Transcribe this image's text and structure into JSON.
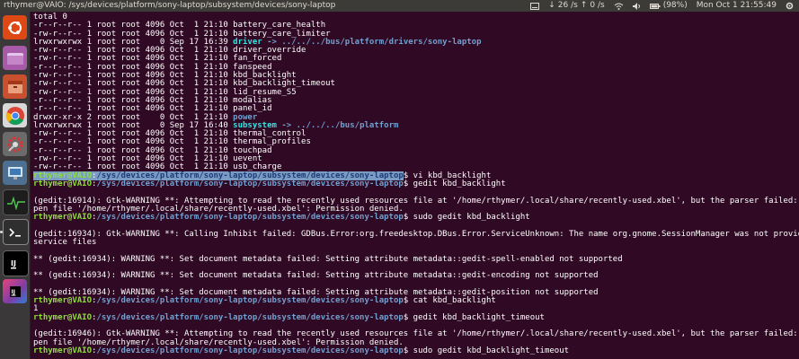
{
  "window": {
    "title": "rthymer@VAIO: /sys/devices/platform/sony-laptop/subsystem/devices/sony-laptop"
  },
  "panel": {
    "network_label": "26 /s",
    "network2_label": "0 /s",
    "battery_label": "(98%)",
    "clock": "Mon Oct  1 21:55:49"
  },
  "launcher": {
    "items": [
      {
        "name": "ubuntu-dash-icon",
        "color": "#e05a1d"
      },
      {
        "name": "files-icon",
        "color": "#b86ab9"
      },
      {
        "name": "archive-icon",
        "color": "#c55439"
      },
      {
        "name": "chrome-icon",
        "color": "#e8e8e8"
      },
      {
        "name": "settings-icon",
        "color": "#bbbbbb"
      },
      {
        "name": "network-icon",
        "color": "#3f7ab5"
      },
      {
        "name": "system-monitor-icon",
        "color": "#2f5f2f"
      },
      {
        "name": "terminal-icon",
        "color": "#2b2b2b"
      },
      {
        "name": "intellij-icon",
        "color": "#1a1a1a"
      },
      {
        "name": "intellij2-icon",
        "color": "#7b3ea9"
      }
    ]
  },
  "terminal": {
    "ls": {
      "total": "total 0",
      "rows": [
        {
          "perms": "-r--r--r-- 1 root root 4096 Oct  1 21:10 ",
          "name": "battery_care_health",
          "type": "file"
        },
        {
          "perms": "-rw-r--r-- 1 root root 4096 Oct  1 21:10 ",
          "name": "battery_care_limiter",
          "type": "file"
        },
        {
          "perms": "lrwxrwxrwx 1 root root    0 Sep 17 16:39 ",
          "name": "driver",
          "type": "link",
          "target": " -> ../../../bus/platform/drivers/sony-laptop"
        },
        {
          "perms": "-rw-r--r-- 1 root root 4096 Oct  1 21:10 ",
          "name": "driver_override",
          "type": "file"
        },
        {
          "perms": "-rw-r--r-- 1 root root 4096 Oct  1 21:10 ",
          "name": "fan_forced",
          "type": "file"
        },
        {
          "perms": "-r--r--r-- 1 root root 4096 Oct  1 21:10 ",
          "name": "fanspeed",
          "type": "file"
        },
        {
          "perms": "-rw-r--r-- 1 root root 4096 Oct  1 21:10 ",
          "name": "kbd_backlight",
          "type": "file"
        },
        {
          "perms": "-rw-r--r-- 1 root root 4096 Oct  1 21:10 ",
          "name": "kbd_backlight_timeout",
          "type": "file"
        },
        {
          "perms": "-rw-r--r-- 1 root root 4096 Oct  1 21:10 ",
          "name": "lid_resume_S5",
          "type": "file"
        },
        {
          "perms": "-r--r--r-- 1 root root 4096 Oct  1 21:10 ",
          "name": "modalias",
          "type": "file"
        },
        {
          "perms": "-r--r--r-- 1 root root 4096 Oct  1 21:10 ",
          "name": "panel_id",
          "type": "file"
        },
        {
          "perms": "drwxr-xr-x 2 root root    0 Oct  1 21:10 ",
          "name": "power",
          "type": "dir"
        },
        {
          "perms": "lrwxrwxrwx 1 root root    0 Sep 17 16:40 ",
          "name": "subsystem",
          "type": "link",
          "target": " -> ../../../bus/platform"
        },
        {
          "perms": "-rw-r--r-- 1 root root 4096 Oct  1 21:10 ",
          "name": "thermal_control",
          "type": "file"
        },
        {
          "perms": "-r--r--r-- 1 root root 4096 Oct  1 21:10 ",
          "name": "thermal_profiles",
          "type": "file"
        },
        {
          "perms": "-r--r--r-- 1 root root 4096 Oct  1 21:10 ",
          "name": "touchpad",
          "type": "file"
        },
        {
          "perms": "-rw-r--r-- 1 root root 4096 Oct  1 21:10 ",
          "name": "uevent",
          "type": "file"
        },
        {
          "perms": "-rw-r--r-- 1 root root 4096 Oct  1 21:10 ",
          "name": "usb_charge",
          "type": "file"
        }
      ]
    },
    "prompt_user": "rthymer@VAIO",
    "prompt_sep": ":",
    "prompt_path": "/sys/devices/platform/sony-laptop/subsystem/devices/sony-laptop",
    "prompt_end": "$ ",
    "session": [
      {
        "kind": "prompt",
        "cmd": "vi kbd_backlight",
        "selected": true
      },
      {
        "kind": "prompt",
        "cmd": "gedit kbd_backlight"
      },
      {
        "kind": "blank"
      },
      {
        "kind": "text",
        "text": "(gedit:16914): Gtk-WARNING **: Attempting to read the recently used resources file at '/home/rthymer/.local/share/recently-used.xbel', but the parser failed: Failed to o"
      },
      {
        "kind": "text",
        "text": "pen file '/home/rthymer/.local/share/recently-used.xbel': Permission denied."
      },
      {
        "kind": "prompt",
        "cmd": "sudo gedit kbd_backlight"
      },
      {
        "kind": "blank"
      },
      {
        "kind": "text",
        "text": "(gedit:16934): Gtk-WARNING **: Calling Inhibit failed: GDBus.Error:org.freedesktop.DBus.Error.ServiceUnknown: The name org.gnome.SessionManager was not provided by any ."
      },
      {
        "kind": "text",
        "text": "service files"
      },
      {
        "kind": "blank"
      },
      {
        "kind": "text",
        "text": "** (gedit:16934): WARNING **: Set document metadata failed: Setting attribute metadata::gedit-spell-enabled not supported"
      },
      {
        "kind": "blank"
      },
      {
        "kind": "text",
        "text": "** (gedit:16934): WARNING **: Set document metadata failed: Setting attribute metadata::gedit-encoding not supported"
      },
      {
        "kind": "blank"
      },
      {
        "kind": "text",
        "text": "** (gedit:16934): WARNING **: Set document metadata failed: Setting attribute metadata::gedit-position not supported"
      },
      {
        "kind": "prompt",
        "cmd": "cat kbd_backlight"
      },
      {
        "kind": "text",
        "text": "1"
      },
      {
        "kind": "prompt",
        "cmd": "gedit kbd_backlight_timeout"
      },
      {
        "kind": "blank"
      },
      {
        "kind": "text",
        "text": "(gedit:16946): Gtk-WARNING **: Attempting to read the recently used resources file at '/home/rthymer/.local/share/recently-used.xbel', but the parser failed: Failed to o"
      },
      {
        "kind": "text",
        "text": "pen file '/home/rthymer/.local/share/recently-used.xbel': Permission denied."
      },
      {
        "kind": "prompt",
        "cmd": "sudo gedit kbd_backlight_timeout"
      }
    ]
  }
}
